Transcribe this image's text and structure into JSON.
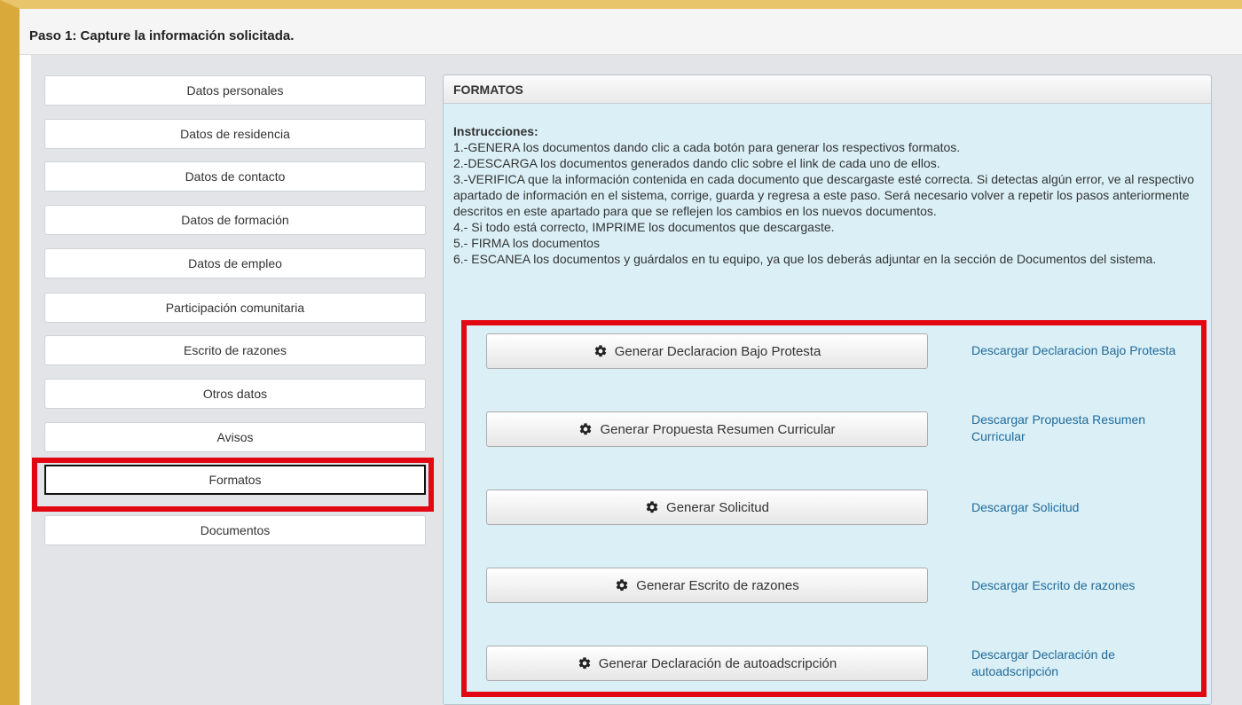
{
  "header": {
    "step_title": "Paso 1: Capture la información solicitada."
  },
  "sidebar": {
    "items": [
      {
        "label": "Datos personales"
      },
      {
        "label": "Datos de residencia"
      },
      {
        "label": "Datos de contacto"
      },
      {
        "label": "Datos de formación"
      },
      {
        "label": "Datos de empleo"
      },
      {
        "label": "Participación comunitaria"
      },
      {
        "label": "Escrito de razones"
      },
      {
        "label": "Otros datos"
      },
      {
        "label": "Avisos"
      },
      {
        "label": "Formatos",
        "active": true
      },
      {
        "label": "Documentos"
      }
    ]
  },
  "panel": {
    "title": "FORMATOS",
    "instructions_label": "Instrucciones:",
    "instructions": [
      "1.-GENERA los documentos dando clic a cada botón para generar los respectivos formatos.",
      "2.-DESCARGA los documentos generados dando clic sobre el link de cada uno de ellos.",
      "3.-VERIFICA que la información contenida en cada documento que descargaste esté correcta. Si detectas algún error, ve al respectivo apartado de información en el sistema, corrige, guarda y regresa a este paso. Será necesario volver a repetir los pasos anteriormente descritos en este apartado para que se reflejen los cambios en los nuevos documentos.",
      "4.- Si todo está correcto, IMPRIME los documentos que descargaste.",
      "5.- FIRMA los documentos",
      "6.- ESCANEA los documentos y guárdalos en tu equipo, ya que los deberás adjuntar en la sección de Documentos del sistema."
    ],
    "actions": [
      {
        "button": "Generar Declaracion Bajo Protesta",
        "link": "Descargar Declaracion Bajo Protesta"
      },
      {
        "button": "Generar Propuesta Resumen Curricular",
        "link": "Descargar Propuesta Resumen Curricular"
      },
      {
        "button": "Generar Solicitud",
        "link": "Descargar Solicitud"
      },
      {
        "button": "Generar Escrito de razones",
        "link": "Descargar Escrito de razones"
      },
      {
        "button": "Generar Declaración de autoadscripción",
        "link": "Descargar Declaración de autoadscripción"
      }
    ]
  },
  "icons": {
    "gear": "gear-icon"
  },
  "colors": {
    "link": "#22699a",
    "highlight": "#e30613",
    "panel_bg": "#daf0f6"
  }
}
